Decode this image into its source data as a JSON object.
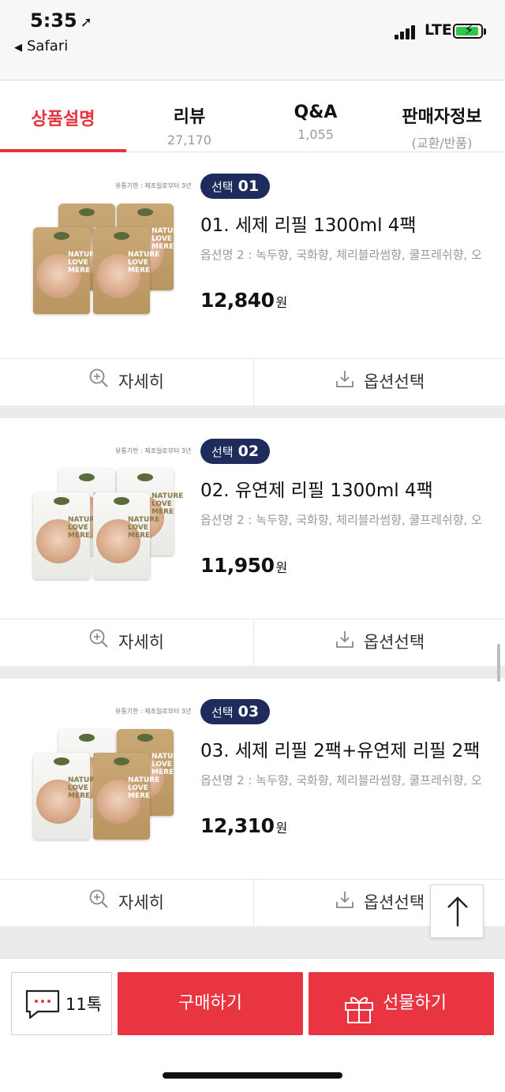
{
  "status_bar": {
    "time": "5:35",
    "back_app": "Safari",
    "network": "LTE",
    "battery_color": "#33c64a"
  },
  "tabs": [
    {
      "label": "상품설명",
      "sub": ""
    },
    {
      "label": "리뷰",
      "sub": "27,170"
    },
    {
      "label": "Q&A",
      "sub": "1,055"
    },
    {
      "label": "판매자정보",
      "sub": "(교환/반품)"
    }
  ],
  "options": [
    {
      "badge_label": "선택",
      "badge_num": "01",
      "title": "01. 세제 리필 1300ml 4팩",
      "option_text": "옵션명 2 : 녹두향, 국화향, 체리블라썸향, 쿨프레쉬향, 오",
      "price": "12,840",
      "currency": "원",
      "detail_label": "자세히",
      "select_label": "옵션선택",
      "image_note": "유통기한 : 제조일로부터 3년",
      "pack_brand": "NATURE LOVE MERE"
    },
    {
      "badge_label": "선택",
      "badge_num": "02",
      "title": "02. 유연제 리필 1300ml 4팩",
      "option_text": "옵션명 2 : 녹두향, 국화향, 체리블라썸향, 쿨프레쉬향, 오",
      "price": "11,950",
      "currency": "원",
      "detail_label": "자세히",
      "select_label": "옵션선택",
      "image_note": "유통기한 : 제조일로부터 3년",
      "pack_brand": "NATURE LOVE MERE"
    },
    {
      "badge_label": "선택",
      "badge_num": "03",
      "title": "03. 세제 리필 2팩+유연제 리필 2팩",
      "option_text": "옵션명 2 : 녹두향, 국화향, 체리블라썸향, 쿨프레쉬향, 오",
      "price": "12,310",
      "currency": "원",
      "detail_label": "자세히",
      "select_label": "옵션선택",
      "image_note": "유통기한 : 제조일로부터 3년",
      "pack_brand": "NATURE LOVE MERE"
    }
  ],
  "bottom_bar": {
    "talk_label": "11톡",
    "buy_label": "구매하기",
    "gift_label": "선물하기"
  },
  "colors": {
    "accent": "#e93541",
    "badge": "#1f2b5b"
  },
  "icons": {
    "scroll_top": "arrow-up-icon",
    "detail": "zoom-in-icon",
    "select": "download-icon",
    "talk": "chat-bubble-icon",
    "gift": "gift-icon"
  }
}
